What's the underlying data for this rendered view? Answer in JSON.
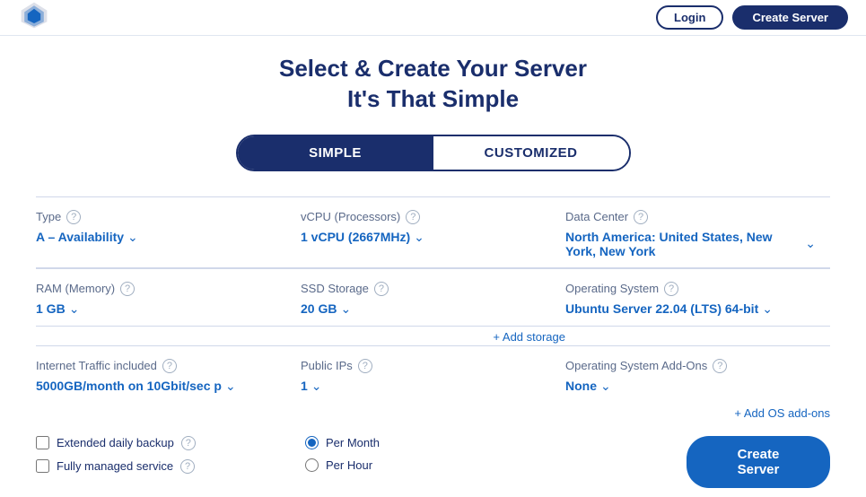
{
  "header": {
    "btn_login": "Login",
    "btn_create": "Create Server"
  },
  "page": {
    "title_line1": "Select & Create Your Server",
    "title_line2": "It's That Simple"
  },
  "toggle": {
    "simple_label": "SIMPLE",
    "customized_label": "CUSTOMIZED"
  },
  "form": {
    "type": {
      "label": "Type",
      "value": "A – Availability"
    },
    "vcpu": {
      "label": "vCPU (Processors)",
      "value": "1 vCPU (2667MHz)"
    },
    "datacenter": {
      "label": "Data Center",
      "value": "North America: United States, New York, New York"
    },
    "ram": {
      "label": "RAM (Memory)",
      "value": "1 GB"
    },
    "ssd": {
      "label": "SSD Storage",
      "value": "20 GB"
    },
    "os": {
      "label": "Operating System",
      "value": "Ubuntu Server 22.04 (LTS) 64-bit"
    },
    "add_storage": "+ Add storage",
    "traffic": {
      "label": "Internet Traffic included",
      "value": "5000GB/month on 10Gbit/sec p"
    },
    "public_ips": {
      "label": "Public IPs",
      "value": "1"
    },
    "os_addons": {
      "label": "Operating System Add-Ons",
      "value": "None"
    },
    "add_os_addons": "+ Add OS add-ons"
  },
  "checkboxes": [
    {
      "label": "Extended daily backup",
      "checked": false
    },
    {
      "label": "Fully managed service",
      "checked": false
    }
  ],
  "billing": {
    "options": [
      {
        "label": "Per Month",
        "selected": true
      },
      {
        "label": "Per Hour",
        "selected": false
      }
    ]
  },
  "create_button": "Create Server"
}
